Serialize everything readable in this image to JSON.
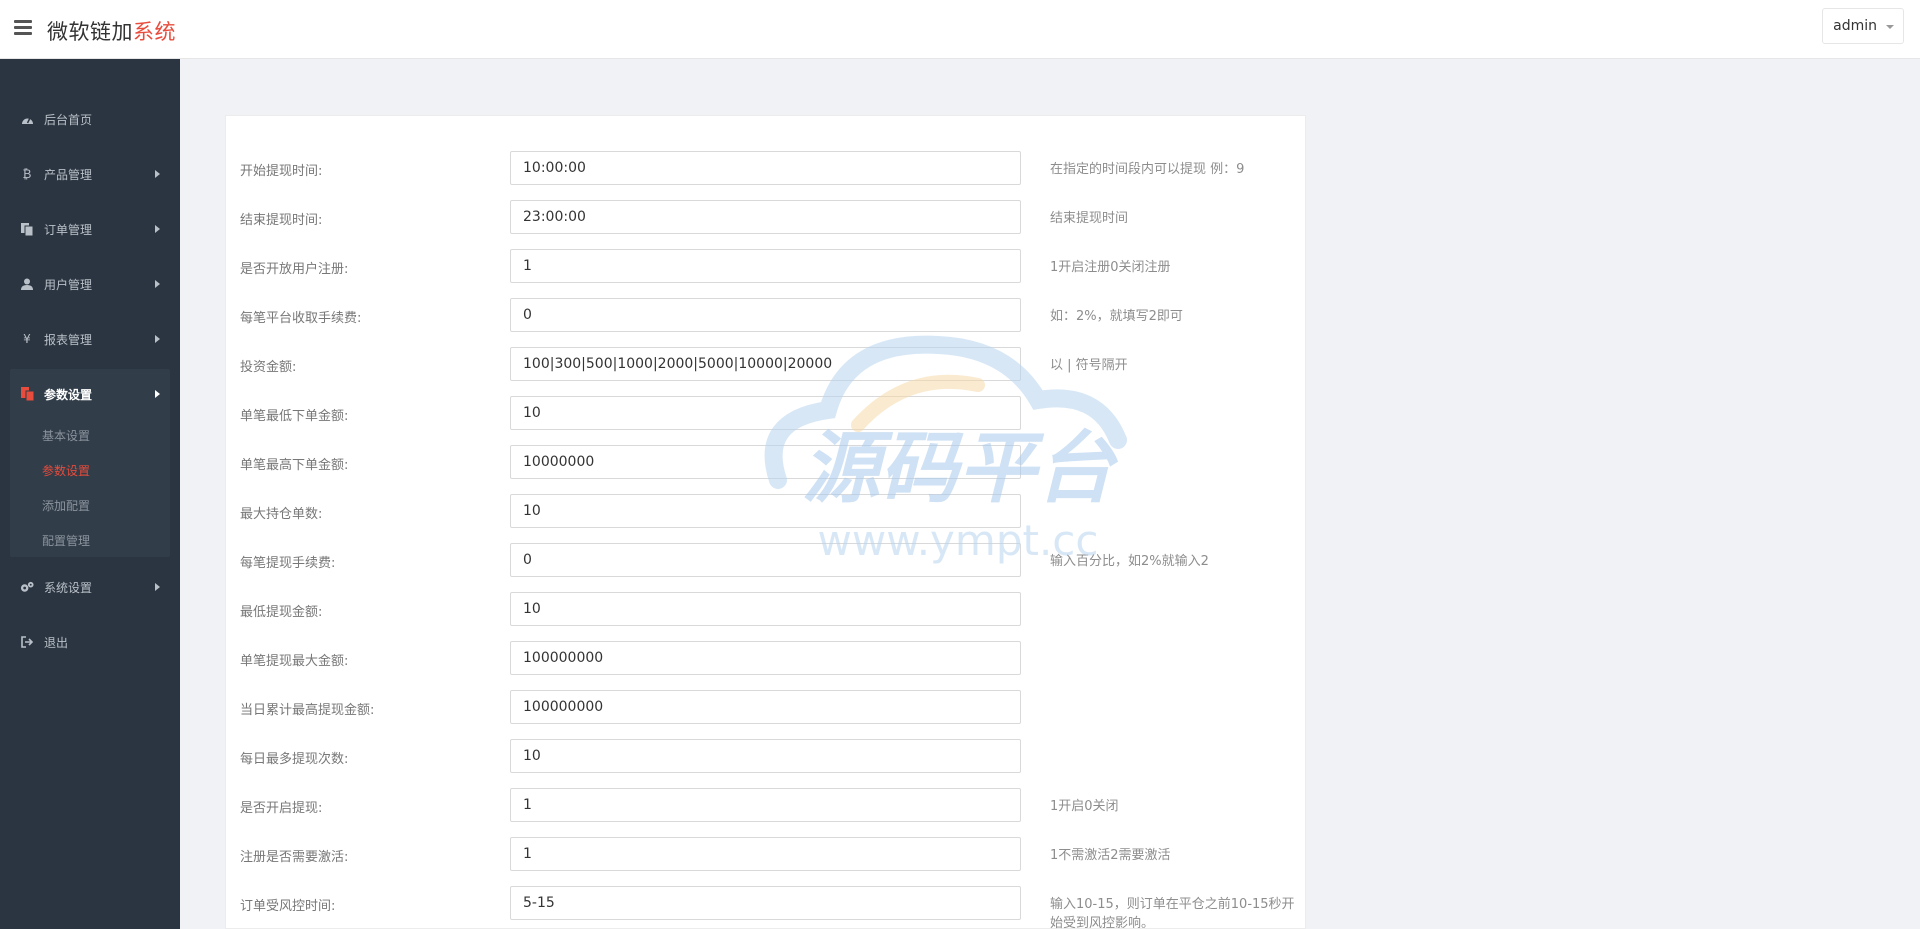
{
  "header": {
    "brand_main": "微软链加",
    "brand_accent": "系统",
    "user": "admin"
  },
  "sidebar": {
    "items": [
      {
        "label": "后台首页",
        "icon": "dashboard-icon"
      },
      {
        "label": "产品管理",
        "icon": "bitcoin-icon"
      },
      {
        "label": "订单管理",
        "icon": "copy-icon"
      },
      {
        "label": "用户管理",
        "icon": "user-icon"
      },
      {
        "label": "报表管理",
        "icon": "yen-icon"
      },
      {
        "label": "参数设置",
        "icon": "files-icon"
      },
      {
        "label": "系统设置",
        "icon": "gears-icon"
      },
      {
        "label": "退出",
        "icon": "sign-out-icon"
      }
    ],
    "sub_items": [
      "基本设置",
      "参数设置",
      "添加配置",
      "配置管理"
    ]
  },
  "form": {
    "rows": [
      {
        "label": "开始提现时间:",
        "value": "10:00:00",
        "hint": "在指定的时间段内可以提现 例：9"
      },
      {
        "label": "结束提现时间:",
        "value": "23:00:00",
        "hint": "结束提现时间"
      },
      {
        "label": "是否开放用户注册:",
        "value": "1",
        "hint": "1开启注册0关闭注册"
      },
      {
        "label": "每笔平台收取手续费:",
        "value": "0",
        "hint": "如：2%，就填写2即可"
      },
      {
        "label": "投资金额:",
        "value": "100|300|500|1000|2000|5000|10000|20000",
        "hint": "以 | 符号隔开"
      },
      {
        "label": "单笔最低下单金额:",
        "value": "10",
        "hint": ""
      },
      {
        "label": "单笔最高下单金额:",
        "value": "10000000",
        "hint": ""
      },
      {
        "label": "最大持仓单数:",
        "value": "10",
        "hint": ""
      },
      {
        "label": "每笔提现手续费:",
        "value": "0",
        "hint": "输入百分比，如2%就输入2"
      },
      {
        "label": "最低提现金额:",
        "value": "10",
        "hint": ""
      },
      {
        "label": "单笔提现最大金额:",
        "value": "100000000",
        "hint": ""
      },
      {
        "label": "当日累计最高提现金额:",
        "value": "100000000",
        "hint": ""
      },
      {
        "label": "每日最多提现次数:",
        "value": "10",
        "hint": ""
      },
      {
        "label": "是否开启提现:",
        "value": "1",
        "hint": "1开启0关闭"
      },
      {
        "label": "注册是否需要激活:",
        "value": "1",
        "hint": "1不需激活2需要激活"
      },
      {
        "label": "订单受风控时间:",
        "value": "5-15",
        "hint": "输入10-15，则订单在平仓之前10-15秒开始受到风控影响。"
      }
    ]
  },
  "watermark": {
    "title": "源码平台",
    "url": "www.ympt.cc"
  },
  "colors": {
    "accent": "#e74c3c",
    "sidebar_bg": "#2b3541",
    "page_bg": "#f0f2f5"
  }
}
